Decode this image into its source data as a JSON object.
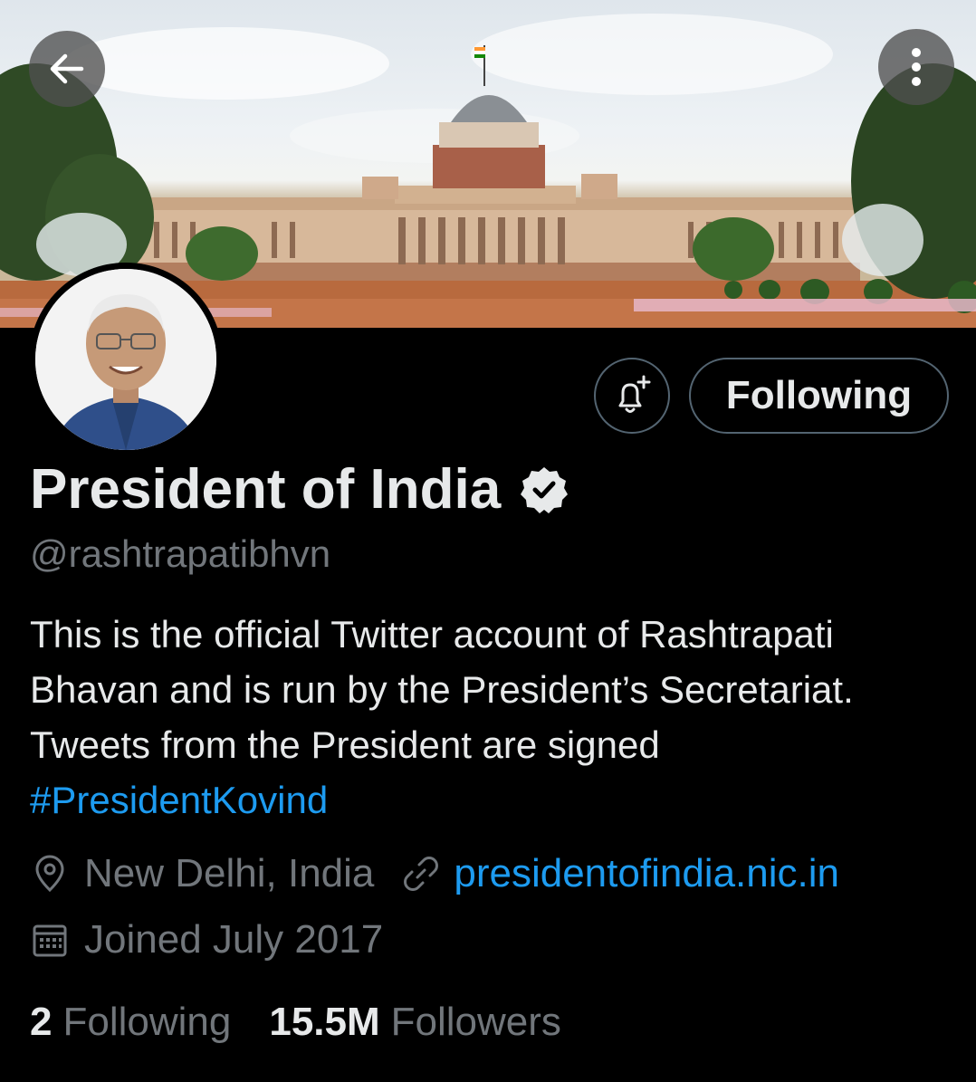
{
  "banner": {
    "description_icon": "building-photo"
  },
  "header": {
    "back_icon": "arrow-left-icon",
    "more_icon": "more-vertical-icon"
  },
  "profile": {
    "name": "President of India",
    "handle": "@rashtrapatibhvn",
    "bio_text": "This is the official Twitter account of Rashtrapati Bhavan and is run by the President’s Secretariat. Tweets from the President are signed ",
    "bio_hashtag": "#PresidentKovind",
    "location": "New Delhi, India",
    "website": "presidentofindia.nic.in",
    "joined": "Joined July 2017",
    "following_count": "2",
    "following_label": "Following",
    "followers_count": "15.5M",
    "followers_label": "Followers"
  },
  "actions": {
    "follow_button_label": "Following",
    "notify_icon": "bell-plus-icon"
  },
  "colors": {
    "background": "#000000",
    "text_primary": "#e7e9ea",
    "text_secondary": "#71767b",
    "link": "#1d9bf0",
    "border": "#536471"
  }
}
